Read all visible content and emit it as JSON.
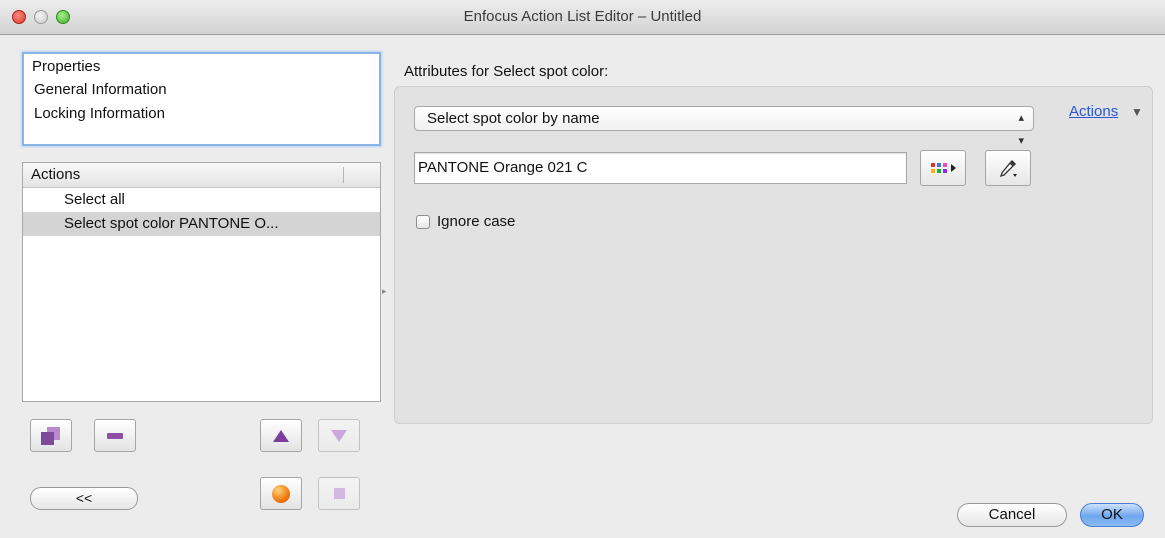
{
  "window": {
    "title": "Enfocus Action List Editor – Untitled"
  },
  "properties": {
    "header": "Properties",
    "items": [
      "General Information",
      "Locking Information"
    ]
  },
  "actions_panel": {
    "header": "Actions",
    "items": [
      "Select all",
      "Select spot color PANTONE O..."
    ],
    "selected_index": 1
  },
  "toolbar": {
    "duplicate_icon": "duplicate-icon",
    "remove_icon": "minus-icon",
    "move_up_icon": "arrow-up-icon",
    "move_down_icon": "arrow-down-icon",
    "record_icon": "record-icon",
    "stop_icon": "stop-icon",
    "collapse_label": "<<"
  },
  "attributes": {
    "label": "Attributes for Select spot color:",
    "mode_select": "Select spot color by name",
    "actions_menu": "Actions",
    "color_name": "PANTONE Orange 021 C",
    "color_picker_icon": "swatch-grid-icon",
    "eyedropper_icon": "eyedropper-icon",
    "ignore_case_label": "Ignore case",
    "ignore_case_checked": false
  },
  "dialog": {
    "cancel": "Cancel",
    "ok": "OK"
  },
  "colors": {
    "accent": "#6ea6ef",
    "link": "#2b57d6",
    "icon_purple": "#7d3d9d",
    "record_orange": "#f07a10"
  }
}
